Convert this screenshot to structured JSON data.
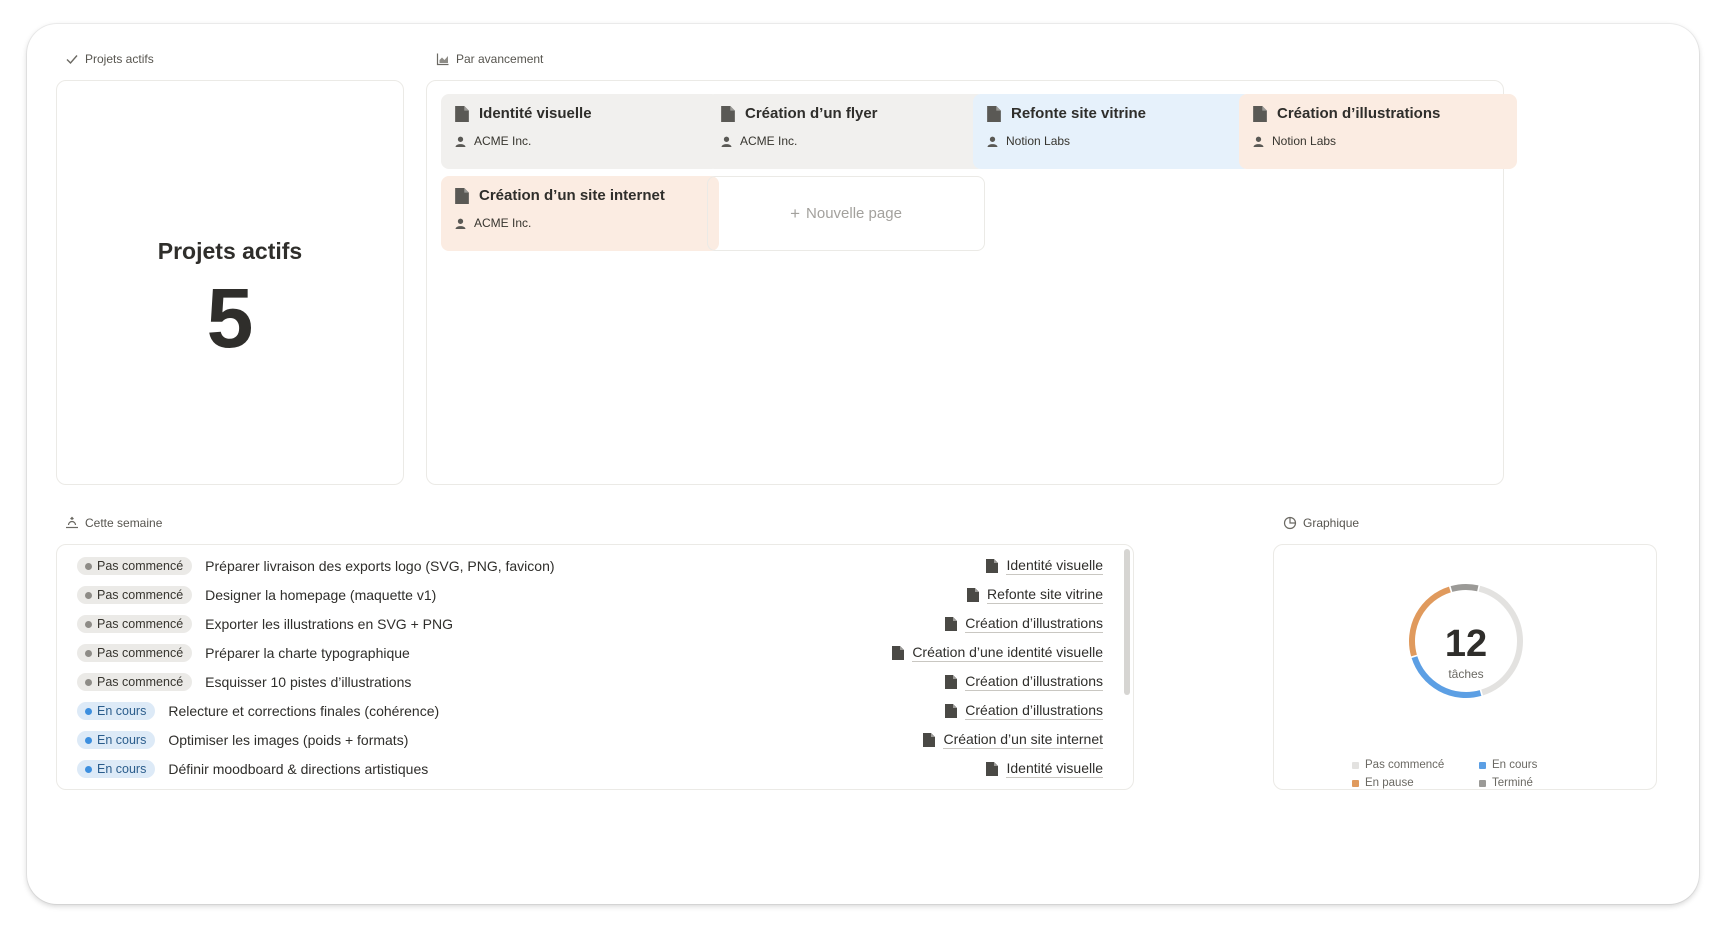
{
  "sections": {
    "active": "Projets actifs",
    "board": "Par avancement",
    "week": "Cette semaine",
    "graph": "Graphique"
  },
  "stat": {
    "title": "Projets actifs",
    "value": "5"
  },
  "board": {
    "cards": [
      {
        "title": "Identité visuelle",
        "client": "ACME Inc.",
        "color": "#f1f0ee"
      },
      {
        "title": "Création d’un flyer",
        "client": "ACME Inc.",
        "color": "#f1f0ee"
      },
      {
        "title": "Refonte site vitrine",
        "client": "Notion Labs",
        "color": "#e6f1fb"
      },
      {
        "title": "Création d’illustrations",
        "client": "Notion Labs",
        "color": "#fbece2"
      },
      {
        "title": "Création d’un site internet",
        "client": "ACME Inc.",
        "color": "#fbece2"
      }
    ],
    "new_page": "Nouvelle page"
  },
  "tasks": [
    {
      "status": "Pas commencé",
      "name": "Préparer livraison des exports logo (SVG, PNG, favicon)",
      "project": "Identité visuelle"
    },
    {
      "status": "Pas commencé",
      "name": "Designer la homepage (maquette v1)",
      "project": "Refonte site vitrine"
    },
    {
      "status": "Pas commencé",
      "name": "Exporter les illustrations en SVG + PNG",
      "project": "Création d’illustrations"
    },
    {
      "status": "Pas commencé",
      "name": "Préparer la charte typographique",
      "project": "Création d’une identité visuelle"
    },
    {
      "status": "Pas commencé",
      "name": "Esquisser 10 pistes d’illustrations",
      "project": "Création d’illustrations"
    },
    {
      "status": "En cours",
      "name": "Relecture et corrections finales (cohérence)",
      "project": "Création d’illustrations"
    },
    {
      "status": "En cours",
      "name": "Optimiser les images (poids + formats)",
      "project": "Création d’un site internet"
    },
    {
      "status": "En cours",
      "name": "Définir moodboard & directions artistiques",
      "project": "Identité visuelle"
    }
  ],
  "chart_data": {
    "type": "pie",
    "variant": "donut",
    "center_value": "12",
    "center_label": "tâches",
    "total": 12,
    "slices": [
      {
        "label": "Pas commencé",
        "value": 5,
        "color": "#e3e2e0"
      },
      {
        "label": "En cours",
        "value": 3,
        "color": "#5c9fe4"
      },
      {
        "label": "En pause",
        "value": 3,
        "color": "#e09a5d"
      },
      {
        "label": "Terminé",
        "value": 1,
        "color": "#9b9a97"
      }
    ],
    "legend": [
      {
        "label": "Pas commencé",
        "color": "#e3e2e0"
      },
      {
        "label": "En cours",
        "color": "#5c9fe4"
      },
      {
        "label": "En pause",
        "color": "#e09a5d"
      },
      {
        "label": "Terminé",
        "color": "#9b9a97"
      }
    ],
    "legend_position": "bottom"
  }
}
